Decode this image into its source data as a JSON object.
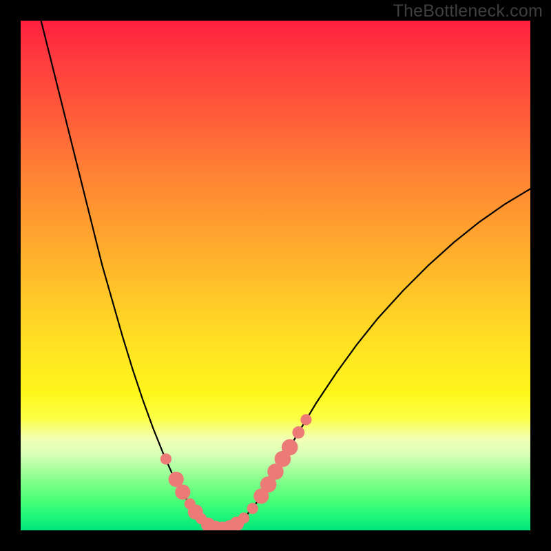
{
  "watermark": "TheBottleneck.com",
  "chart_data": {
    "type": "line",
    "title": "",
    "xlabel": "",
    "ylabel": "",
    "xlim": [
      0,
      100
    ],
    "ylim": [
      0,
      100
    ],
    "curve": {
      "name": "bottleneck-curve",
      "color": "#000000",
      "points": [
        {
          "x": 4,
          "y": 100
        },
        {
          "x": 6,
          "y": 92
        },
        {
          "x": 8,
          "y": 84
        },
        {
          "x": 10,
          "y": 76
        },
        {
          "x": 12,
          "y": 68
        },
        {
          "x": 14,
          "y": 60
        },
        {
          "x": 16,
          "y": 52
        },
        {
          "x": 18,
          "y": 45
        },
        {
          "x": 20,
          "y": 38
        },
        {
          "x": 22,
          "y": 31.5
        },
        {
          "x": 24,
          "y": 25.5
        },
        {
          "x": 26,
          "y": 20
        },
        {
          "x": 28,
          "y": 15
        },
        {
          "x": 30,
          "y": 10.5
        },
        {
          "x": 32,
          "y": 7
        },
        {
          "x": 33.5,
          "y": 4.5
        },
        {
          "x": 35,
          "y": 2.5
        },
        {
          "x": 36.5,
          "y": 1.2
        },
        {
          "x": 38,
          "y": 0.5
        },
        {
          "x": 39.5,
          "y": 0.3
        },
        {
          "x": 41,
          "y": 0.6
        },
        {
          "x": 42.5,
          "y": 1.3
        },
        {
          "x": 44,
          "y": 2.6
        },
        {
          "x": 46,
          "y": 5
        },
        {
          "x": 48,
          "y": 8
        },
        {
          "x": 50,
          "y": 11.5
        },
        {
          "x": 52,
          "y": 15
        },
        {
          "x": 55,
          "y": 20
        },
        {
          "x": 58,
          "y": 25
        },
        {
          "x": 62,
          "y": 31
        },
        {
          "x": 66,
          "y": 36.5
        },
        {
          "x": 70,
          "y": 41.5
        },
        {
          "x": 75,
          "y": 47
        },
        {
          "x": 80,
          "y": 52
        },
        {
          "x": 85,
          "y": 56.5
        },
        {
          "x": 90,
          "y": 60.5
        },
        {
          "x": 95,
          "y": 64
        },
        {
          "x": 100,
          "y": 67
        }
      ]
    },
    "markers": {
      "name": "highlight-markers",
      "color": "#ec7b78",
      "points": [
        {
          "x": 28.5,
          "y": 14,
          "r": 1.1
        },
        {
          "x": 30.5,
          "y": 10,
          "r": 1.5
        },
        {
          "x": 31.8,
          "y": 7.5,
          "r": 1.5
        },
        {
          "x": 33.2,
          "y": 5.2,
          "r": 1.1
        },
        {
          "x": 34.3,
          "y": 3.6,
          "r": 1.5
        },
        {
          "x": 35.4,
          "y": 2.3,
          "r": 1.1
        },
        {
          "x": 36.8,
          "y": 1.1,
          "r": 1.4
        },
        {
          "x": 38.2,
          "y": 0.5,
          "r": 1.4
        },
        {
          "x": 39.6,
          "y": 0.3,
          "r": 1.4
        },
        {
          "x": 41.0,
          "y": 0.6,
          "r": 1.4
        },
        {
          "x": 42.4,
          "y": 1.3,
          "r": 1.4
        },
        {
          "x": 43.8,
          "y": 2.4,
          "r": 1.1
        },
        {
          "x": 45.5,
          "y": 4.3,
          "r": 1.1
        },
        {
          "x": 47.2,
          "y": 6.7,
          "r": 1.5
        },
        {
          "x": 48.6,
          "y": 9.0,
          "r": 1.6
        },
        {
          "x": 50.0,
          "y": 11.5,
          "r": 1.6
        },
        {
          "x": 51.4,
          "y": 14.0,
          "r": 1.6
        },
        {
          "x": 52.8,
          "y": 16.3,
          "r": 1.6
        },
        {
          "x": 54.5,
          "y": 19.2,
          "r": 1.2
        },
        {
          "x": 56.0,
          "y": 21.7,
          "r": 1.1
        }
      ]
    }
  }
}
